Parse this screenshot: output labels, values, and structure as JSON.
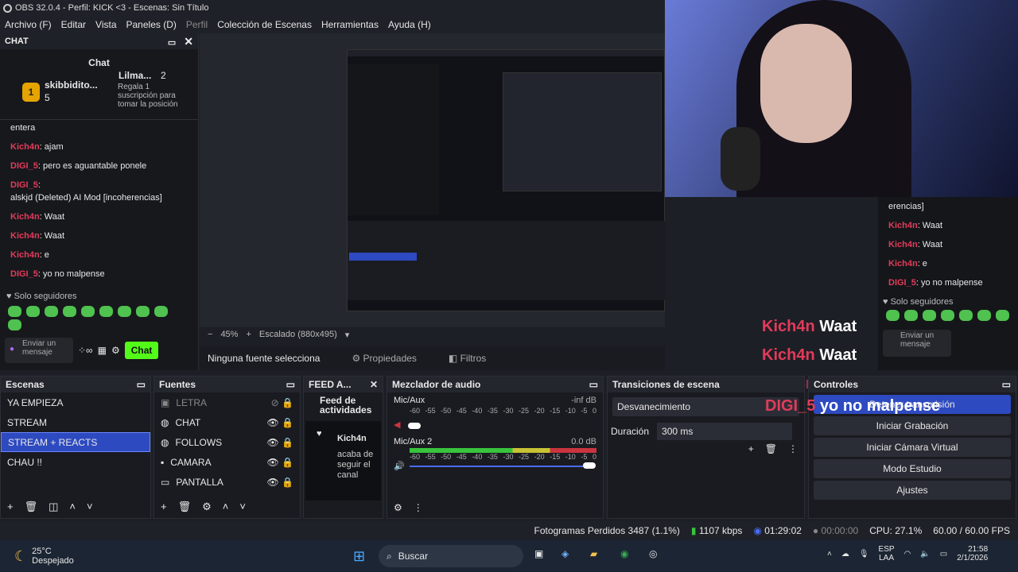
{
  "window": {
    "title": "OBS 32.0.4 - Perfil: KICK <3 - Escenas: Sin Título"
  },
  "menu": [
    "Archivo (F)",
    "Editar",
    "Vista",
    "Paneles (D)",
    "Perfil",
    "Colección de Escenas",
    "Herramientas",
    "Ayuda (H)"
  ],
  "chat": {
    "dock_title": "CHAT",
    "title": "Chat",
    "top1_name": "skibbidito...",
    "top1_count": "5",
    "top2_name": "Lilma...",
    "top2_count": "2",
    "pin_text": "Regala 1 suscripción para tomar la posición 3",
    "messages": [
      {
        "user": "",
        "text": "entera"
      },
      {
        "user": "Kich4n",
        "text": ": ajam"
      },
      {
        "user": "DIGI_5",
        "text": ": pero es aguantable ponele"
      },
      {
        "user": "DIGI_5",
        "text": ":"
      },
      {
        "user": "",
        "text": "alskjd (Deleted) AI Mod [incoherencias]"
      },
      {
        "user": "Kich4n",
        "text": ": Waat"
      },
      {
        "user": "Kich4n",
        "text": ": Waat"
      },
      {
        "user": "Kich4n",
        "text": ": e"
      },
      {
        "user": "DIGI_5",
        "text": ": yo no malpense"
      }
    ],
    "followers_only": "Solo seguidores",
    "input_placeholder": "Enviar un mensaje",
    "send_label": "Chat"
  },
  "preview": {
    "zoom": "45%",
    "scale": "Escalado (880x495)",
    "no_source": "Ninguna fuente selecciona",
    "properties": "Propiedades",
    "filters": "Filtros"
  },
  "overlay_chat": [
    {
      "user": "Kich4n",
      "text": "Waat"
    },
    {
      "user": "Kich4n",
      "text": "Waat"
    },
    {
      "user": "Kich4n",
      "text": ""
    },
    {
      "user": "DIGI_5",
      "text": "yo no malpense"
    }
  ],
  "right_chat": {
    "messages": [
      {
        "user": "",
        "text": "erencias]"
      },
      {
        "user": "Kich4n",
        "text": ": Waat"
      },
      {
        "user": "Kich4n",
        "text": ": Waat"
      },
      {
        "user": "Kich4n",
        "text": ": e"
      },
      {
        "user": "DIGI_5",
        "text": ": yo no malpense"
      }
    ],
    "followers_only": "Solo seguidores",
    "input_placeholder": "Enviar un mensaje"
  },
  "scenes": {
    "title": "Escenas",
    "items": [
      "YA EMPIEZA",
      "STREAM",
      "STREAM + REACTS",
      "CHAU !!"
    ],
    "selected": 2
  },
  "sources": {
    "title": "Fuentes",
    "items": [
      "LETRA",
      "CHAT",
      "FOLLOWS",
      "CAMARA",
      "PANTALLA"
    ]
  },
  "feed": {
    "title": "FEED A...",
    "header": "Feed de actividades",
    "user": "Kich4n",
    "text": "acaba de seguir el canal"
  },
  "mixer": {
    "title": "Mezclador de audio",
    "ch1": "Mic/Aux",
    "ch1_db": "-inf dB",
    "ch2": "Mic/Aux 2",
    "ch2_db": "0.0 dB",
    "scale": [
      "-60",
      "-55",
      "-50",
      "-45",
      "-40",
      "-35",
      "-30",
      "-25",
      "-20",
      "-15",
      "-10",
      "-5",
      "0"
    ]
  },
  "transitions": {
    "title": "Transiciones de escena",
    "type": "Desvanecimiento",
    "duration_label": "Duración",
    "duration": "300 ms"
  },
  "controls": {
    "title": "Controles",
    "stream": "Detener transmisión",
    "record": "Iniciar Grabación",
    "vcam": "Iniciar Cámara Virtual",
    "studio": "Modo Estudio",
    "settings": "Ajustes"
  },
  "status": {
    "dropped": "Fotogramas Perdidos 3487 (1.1%)",
    "kbps": "1107 kbps",
    "live": "01:29:02",
    "rec": "00:00:00",
    "cpu": "CPU: 27.1%",
    "fps": "60.00 / 60.00 FPS"
  },
  "taskbar": {
    "temp": "25°C",
    "weather": "Despejado",
    "search": "Buscar",
    "lang1": "ESP",
    "lang2": "LAA",
    "time": "21:58",
    "date": "2/1/2026"
  },
  "colors": {
    "accent": "#2e4ac0",
    "kick_green": "#53fc18",
    "user_red": "#e23b5a"
  }
}
